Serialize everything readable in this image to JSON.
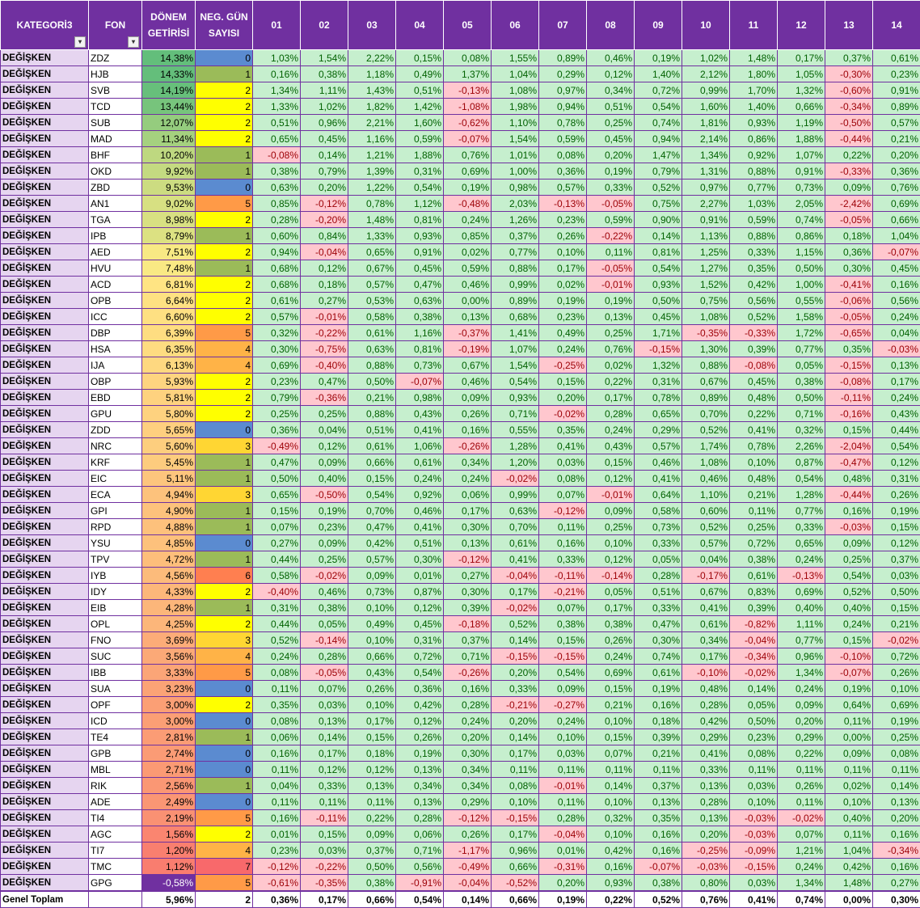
{
  "headers": [
    "KATEGORİ3",
    "FON",
    "DÖNEM GETİRİSİ",
    "NEG. GÜN SAYISI",
    "01",
    "02",
    "03",
    "04",
    "05",
    "06",
    "07",
    "08",
    "09",
    "10",
    "11",
    "12",
    "13",
    "14"
  ],
  "colors": {
    "header_bg": "#7030a0",
    "pos_bg": "#c6efce",
    "pos_fg": "#006100",
    "neg_bg": "#ffc7ce",
    "neg_fg": "#9c0006",
    "cat_bg": "#e6d5f0"
  },
  "rows": [
    {
      "k": "DEĞİŞKEN",
      "f": "ZDZ",
      "g": "14,38%",
      "n": "0",
      "d": [
        "1,03%",
        "1,54%",
        "2,22%",
        "0,15%",
        "0,08%",
        "1,55%",
        "0,89%",
        "0,46%",
        "0,19%",
        "1,02%",
        "1,48%",
        "0,17%",
        "0,37%",
        "0,61%"
      ]
    },
    {
      "k": "DEĞİŞKEN",
      "f": "HJB",
      "g": "14,33%",
      "n": "1",
      "d": [
        "0,16%",
        "0,38%",
        "1,18%",
        "0,49%",
        "1,37%",
        "1,04%",
        "0,29%",
        "0,12%",
        "1,40%",
        "2,12%",
        "1,80%",
        "1,05%",
        "-0,30%",
        "0,23%"
      ]
    },
    {
      "k": "DEĞİŞKEN",
      "f": "SVB",
      "g": "14,19%",
      "n": "2",
      "d": [
        "1,34%",
        "1,11%",
        "1,43%",
        "0,51%",
        "-0,13%",
        "1,08%",
        "0,97%",
        "0,34%",
        "0,72%",
        "0,99%",
        "1,70%",
        "1,32%",
        "-0,60%",
        "0,91%"
      ]
    },
    {
      "k": "DEĞİŞKEN",
      "f": "TCD",
      "g": "13,44%",
      "n": "2",
      "d": [
        "1,33%",
        "1,02%",
        "1,82%",
        "1,42%",
        "-1,08%",
        "1,98%",
        "0,94%",
        "0,51%",
        "0,54%",
        "1,60%",
        "1,40%",
        "0,66%",
        "-0,34%",
        "0,89%"
      ]
    },
    {
      "k": "DEĞİŞKEN",
      "f": "SUB",
      "g": "12,07%",
      "n": "2",
      "d": [
        "0,51%",
        "0,96%",
        "2,21%",
        "1,60%",
        "-0,62%",
        "1,10%",
        "0,78%",
        "0,25%",
        "0,74%",
        "1,81%",
        "0,93%",
        "1,19%",
        "-0,50%",
        "0,57%"
      ]
    },
    {
      "k": "DEĞİŞKEN",
      "f": "MAD",
      "g": "11,34%",
      "n": "2",
      "d": [
        "0,65%",
        "0,45%",
        "1,16%",
        "0,59%",
        "-0,07%",
        "1,54%",
        "0,59%",
        "0,45%",
        "0,94%",
        "2,14%",
        "0,86%",
        "1,88%",
        "-0,44%",
        "0,21%"
      ]
    },
    {
      "k": "DEĞİŞKEN",
      "f": "BHF",
      "g": "10,20%",
      "n": "1",
      "d": [
        "-0,08%",
        "0,14%",
        "1,21%",
        "1,88%",
        "0,76%",
        "1,01%",
        "0,08%",
        "0,20%",
        "1,47%",
        "1,34%",
        "0,92%",
        "1,07%",
        "0,22%",
        "0,20%"
      ]
    },
    {
      "k": "DEĞİŞKEN",
      "f": "OKD",
      "g": "9,92%",
      "n": "1",
      "d": [
        "0,38%",
        "0,79%",
        "1,39%",
        "0,31%",
        "0,69%",
        "1,00%",
        "0,36%",
        "0,19%",
        "0,79%",
        "1,31%",
        "0,88%",
        "0,91%",
        "-0,33%",
        "0,36%"
      ]
    },
    {
      "k": "DEĞİŞKEN",
      "f": "ZBD",
      "g": "9,53%",
      "n": "0",
      "d": [
        "0,63%",
        "0,20%",
        "1,22%",
        "0,54%",
        "0,19%",
        "0,98%",
        "0,57%",
        "0,33%",
        "0,52%",
        "0,97%",
        "0,77%",
        "0,73%",
        "0,09%",
        "0,76%"
      ]
    },
    {
      "k": "DEĞİŞKEN",
      "f": "AN1",
      "g": "9,02%",
      "n": "5",
      "d": [
        "0,85%",
        "-0,12%",
        "0,78%",
        "1,12%",
        "-0,48%",
        "2,03%",
        "-0,13%",
        "-0,05%",
        "0,75%",
        "2,27%",
        "1,03%",
        "2,05%",
        "-2,42%",
        "0,69%"
      ]
    },
    {
      "k": "DEĞİŞKEN",
      "f": "TGA",
      "g": "8,98%",
      "n": "2",
      "d": [
        "0,28%",
        "-0,20%",
        "1,48%",
        "0,81%",
        "0,24%",
        "1,26%",
        "0,23%",
        "0,59%",
        "0,90%",
        "0,91%",
        "0,59%",
        "0,74%",
        "-0,05%",
        "0,66%"
      ]
    },
    {
      "k": "DEĞİŞKEN",
      "f": "IPB",
      "g": "8,79%",
      "n": "1",
      "d": [
        "0,60%",
        "0,84%",
        "1,33%",
        "0,93%",
        "0,85%",
        "0,37%",
        "0,26%",
        "-0,22%",
        "0,14%",
        "1,13%",
        "0,88%",
        "0,86%",
        "0,18%",
        "1,04%"
      ]
    },
    {
      "k": "DEĞİŞKEN",
      "f": "AED",
      "g": "7,51%",
      "n": "2",
      "d": [
        "0,94%",
        "-0,04%",
        "0,65%",
        "0,91%",
        "0,02%",
        "0,77%",
        "0,10%",
        "0,11%",
        "0,81%",
        "1,25%",
        "0,33%",
        "1,15%",
        "0,36%",
        "-0,07%"
      ]
    },
    {
      "k": "DEĞİŞKEN",
      "f": "HVU",
      "g": "7,48%",
      "n": "1",
      "d": [
        "0,68%",
        "0,12%",
        "0,67%",
        "0,45%",
        "0,59%",
        "0,88%",
        "0,17%",
        "-0,05%",
        "0,54%",
        "1,27%",
        "0,35%",
        "0,50%",
        "0,30%",
        "0,45%"
      ]
    },
    {
      "k": "DEĞİŞKEN",
      "f": "ACD",
      "g": "6,81%",
      "n": "2",
      "d": [
        "0,68%",
        "0,18%",
        "0,57%",
        "0,47%",
        "0,46%",
        "0,99%",
        "0,02%",
        "-0,01%",
        "0,93%",
        "1,52%",
        "0,42%",
        "1,00%",
        "-0,41%",
        "0,16%"
      ]
    },
    {
      "k": "DEĞİŞKEN",
      "f": "OPB",
      "g": "6,64%",
      "n": "2",
      "d": [
        "0,61%",
        "0,27%",
        "0,53%",
        "0,63%",
        "0,00%",
        "0,89%",
        "0,19%",
        "0,19%",
        "0,50%",
        "0,75%",
        "0,56%",
        "0,55%",
        "-0,06%",
        "0,56%"
      ]
    },
    {
      "k": "DEĞİŞKEN",
      "f": "ICC",
      "g": "6,60%",
      "n": "2",
      "d": [
        "0,57%",
        "-0,01%",
        "0,58%",
        "0,38%",
        "0,13%",
        "0,68%",
        "0,23%",
        "0,13%",
        "0,45%",
        "1,08%",
        "0,52%",
        "1,58%",
        "-0,05%",
        "0,24%"
      ]
    },
    {
      "k": "DEĞİŞKEN",
      "f": "DBP",
      "g": "6,39%",
      "n": "5",
      "d": [
        "0,32%",
        "-0,22%",
        "0,61%",
        "1,16%",
        "-0,37%",
        "1,41%",
        "0,49%",
        "0,25%",
        "1,71%",
        "-0,35%",
        "-0,33%",
        "1,72%",
        "-0,65%",
        "0,04%"
      ]
    },
    {
      "k": "DEĞİŞKEN",
      "f": "HSA",
      "g": "6,35%",
      "n": "4",
      "d": [
        "0,30%",
        "-0,75%",
        "0,63%",
        "0,81%",
        "-0,19%",
        "1,07%",
        "0,24%",
        "0,76%",
        "-0,15%",
        "1,30%",
        "0,39%",
        "0,77%",
        "0,35%",
        "-0,03%"
      ]
    },
    {
      "k": "DEĞİŞKEN",
      "f": "IJA",
      "g": "6,13%",
      "n": "4",
      "d": [
        "0,69%",
        "-0,40%",
        "0,88%",
        "0,73%",
        "0,67%",
        "1,54%",
        "-0,25%",
        "0,02%",
        "1,32%",
        "0,88%",
        "-0,08%",
        "0,05%",
        "-0,15%",
        "0,13%"
      ]
    },
    {
      "k": "DEĞİŞKEN",
      "f": "OBP",
      "g": "5,93%",
      "n": "2",
      "d": [
        "0,23%",
        "0,47%",
        "0,50%",
        "-0,07%",
        "0,46%",
        "0,54%",
        "0,15%",
        "0,22%",
        "0,31%",
        "0,67%",
        "0,45%",
        "0,38%",
        "-0,08%",
        "0,17%"
      ]
    },
    {
      "k": "DEĞİŞKEN",
      "f": "EBD",
      "g": "5,81%",
      "n": "2",
      "d": [
        "0,79%",
        "-0,36%",
        "0,21%",
        "0,98%",
        "0,09%",
        "0,93%",
        "0,20%",
        "0,17%",
        "0,78%",
        "0,89%",
        "0,48%",
        "0,50%",
        "-0,11%",
        "0,24%"
      ]
    },
    {
      "k": "DEĞİŞKEN",
      "f": "GPU",
      "g": "5,80%",
      "n": "2",
      "d": [
        "0,25%",
        "0,25%",
        "0,88%",
        "0,43%",
        "0,26%",
        "0,71%",
        "-0,02%",
        "0,28%",
        "0,65%",
        "0,70%",
        "0,22%",
        "0,71%",
        "-0,16%",
        "0,43%"
      ]
    },
    {
      "k": "DEĞİŞKEN",
      "f": "ZDD",
      "g": "5,65%",
      "n": "0",
      "d": [
        "0,36%",
        "0,04%",
        "0,51%",
        "0,41%",
        "0,16%",
        "0,55%",
        "0,35%",
        "0,24%",
        "0,29%",
        "0,52%",
        "0,41%",
        "0,32%",
        "0,15%",
        "0,44%"
      ]
    },
    {
      "k": "DEĞİŞKEN",
      "f": "NRC",
      "g": "5,60%",
      "n": "3",
      "d": [
        "-0,49%",
        "0,12%",
        "0,61%",
        "1,06%",
        "-0,26%",
        "1,28%",
        "0,41%",
        "0,43%",
        "0,57%",
        "1,74%",
        "0,78%",
        "2,26%",
        "-2,04%",
        "0,54%"
      ]
    },
    {
      "k": "DEĞİŞKEN",
      "f": "KRF",
      "g": "5,45%",
      "n": "1",
      "d": [
        "0,47%",
        "0,09%",
        "0,66%",
        "0,61%",
        "0,34%",
        "1,20%",
        "0,03%",
        "0,15%",
        "0,46%",
        "1,08%",
        "0,10%",
        "0,87%",
        "-0,47%",
        "0,12%"
      ]
    },
    {
      "k": "DEĞİŞKEN",
      "f": "EIC",
      "g": "5,11%",
      "n": "1",
      "d": [
        "0,50%",
        "0,40%",
        "0,15%",
        "0,24%",
        "0,24%",
        "-0,02%",
        "0,08%",
        "0,12%",
        "0,41%",
        "0,46%",
        "0,48%",
        "0,54%",
        "0,48%",
        "0,31%"
      ]
    },
    {
      "k": "DEĞİŞKEN",
      "f": "ECA",
      "g": "4,94%",
      "n": "3",
      "d": [
        "0,65%",
        "-0,50%",
        "0,54%",
        "0,92%",
        "0,06%",
        "0,99%",
        "0,07%",
        "-0,01%",
        "0,64%",
        "1,10%",
        "0,21%",
        "1,28%",
        "-0,44%",
        "0,26%"
      ]
    },
    {
      "k": "DEĞİŞKEN",
      "f": "GPI",
      "g": "4,90%",
      "n": "1",
      "d": [
        "0,15%",
        "0,19%",
        "0,70%",
        "0,46%",
        "0,17%",
        "0,63%",
        "-0,12%",
        "0,09%",
        "0,58%",
        "0,60%",
        "0,11%",
        "0,77%",
        "0,16%",
        "0,19%"
      ]
    },
    {
      "k": "DEĞİŞKEN",
      "f": "RPD",
      "g": "4,88%",
      "n": "1",
      "d": [
        "0,07%",
        "0,23%",
        "0,47%",
        "0,41%",
        "0,30%",
        "0,70%",
        "0,11%",
        "0,25%",
        "0,73%",
        "0,52%",
        "0,25%",
        "0,33%",
        "-0,03%",
        "0,15%"
      ]
    },
    {
      "k": "DEĞİŞKEN",
      "f": "YSU",
      "g": "4,85%",
      "n": "0",
      "d": [
        "0,27%",
        "0,09%",
        "0,42%",
        "0,51%",
        "0,13%",
        "0,61%",
        "0,16%",
        "0,10%",
        "0,33%",
        "0,57%",
        "0,72%",
        "0,65%",
        "0,09%",
        "0,12%"
      ]
    },
    {
      "k": "DEĞİŞKEN",
      "f": "TPV",
      "g": "4,72%",
      "n": "1",
      "d": [
        "0,44%",
        "0,25%",
        "0,57%",
        "0,30%",
        "-0,12%",
        "0,41%",
        "0,33%",
        "0,12%",
        "0,05%",
        "0,04%",
        "0,38%",
        "0,24%",
        "0,25%",
        "0,37%"
      ]
    },
    {
      "k": "DEĞİŞKEN",
      "f": "IYB",
      "g": "4,56%",
      "n": "6",
      "d": [
        "0,58%",
        "-0,02%",
        "0,09%",
        "0,01%",
        "0,27%",
        "-0,04%",
        "-0,11%",
        "-0,14%",
        "0,28%",
        "-0,17%",
        "0,61%",
        "-0,13%",
        "0,54%",
        "0,03%"
      ]
    },
    {
      "k": "DEĞİŞKEN",
      "f": "IDY",
      "g": "4,33%",
      "n": "2",
      "d": [
        "-0,40%",
        "0,46%",
        "0,73%",
        "0,87%",
        "0,30%",
        "0,17%",
        "-0,21%",
        "0,05%",
        "0,51%",
        "0,67%",
        "0,83%",
        "0,69%",
        "0,52%",
        "0,50%"
      ]
    },
    {
      "k": "DEĞİŞKEN",
      "f": "EIB",
      "g": "4,28%",
      "n": "1",
      "d": [
        "0,31%",
        "0,38%",
        "0,10%",
        "0,12%",
        "0,39%",
        "-0,02%",
        "0,07%",
        "0,17%",
        "0,33%",
        "0,41%",
        "0,39%",
        "0,40%",
        "0,40%",
        "0,15%"
      ]
    },
    {
      "k": "DEĞİŞKEN",
      "f": "OPL",
      "g": "4,25%",
      "n": "2",
      "d": [
        "0,44%",
        "0,05%",
        "0,49%",
        "0,45%",
        "-0,18%",
        "0,52%",
        "0,38%",
        "0,38%",
        "0,47%",
        "0,61%",
        "-0,82%",
        "1,11%",
        "0,24%",
        "0,21%"
      ]
    },
    {
      "k": "DEĞİŞKEN",
      "f": "FNO",
      "g": "3,69%",
      "n": "3",
      "d": [
        "0,52%",
        "-0,14%",
        "0,10%",
        "0,31%",
        "0,37%",
        "0,14%",
        "0,15%",
        "0,26%",
        "0,30%",
        "0,34%",
        "-0,04%",
        "0,77%",
        "0,15%",
        "-0,02%"
      ]
    },
    {
      "k": "DEĞİŞKEN",
      "f": "SUC",
      "g": "3,56%",
      "n": "4",
      "d": [
        "0,24%",
        "0,28%",
        "0,66%",
        "0,72%",
        "0,71%",
        "-0,15%",
        "-0,15%",
        "0,24%",
        "0,74%",
        "0,17%",
        "-0,34%",
        "0,96%",
        "-0,10%",
        "0,72%"
      ]
    },
    {
      "k": "DEĞİŞKEN",
      "f": "IBB",
      "g": "3,33%",
      "n": "5",
      "d": [
        "0,08%",
        "-0,05%",
        "0,43%",
        "0,54%",
        "-0,26%",
        "0,20%",
        "0,54%",
        "0,69%",
        "0,61%",
        "-0,10%",
        "-0,02%",
        "1,34%",
        "-0,07%",
        "0,26%"
      ]
    },
    {
      "k": "DEĞİŞKEN",
      "f": "SUA",
      "g": "3,23%",
      "n": "0",
      "d": [
        "0,11%",
        "0,07%",
        "0,26%",
        "0,36%",
        "0,16%",
        "0,33%",
        "0,09%",
        "0,15%",
        "0,19%",
        "0,48%",
        "0,14%",
        "0,24%",
        "0,19%",
        "0,10%"
      ]
    },
    {
      "k": "DEĞİŞKEN",
      "f": "OPF",
      "g": "3,00%",
      "n": "2",
      "d": [
        "0,35%",
        "0,03%",
        "0,10%",
        "0,42%",
        "0,28%",
        "-0,21%",
        "-0,27%",
        "0,21%",
        "0,16%",
        "0,28%",
        "0,05%",
        "0,09%",
        "0,64%",
        "0,69%"
      ]
    },
    {
      "k": "DEĞİŞKEN",
      "f": "ICD",
      "g": "3,00%",
      "n": "0",
      "d": [
        "0,08%",
        "0,13%",
        "0,17%",
        "0,12%",
        "0,24%",
        "0,20%",
        "0,24%",
        "0,10%",
        "0,18%",
        "0,42%",
        "0,50%",
        "0,20%",
        "0,11%",
        "0,19%"
      ]
    },
    {
      "k": "DEĞİŞKEN",
      "f": "TE4",
      "g": "2,81%",
      "n": "1",
      "d": [
        "0,06%",
        "0,14%",
        "0,15%",
        "0,26%",
        "0,20%",
        "0,14%",
        "0,10%",
        "0,15%",
        "0,39%",
        "0,29%",
        "0,23%",
        "0,29%",
        "0,00%",
        "0,25%"
      ]
    },
    {
      "k": "DEĞİŞKEN",
      "f": "GPB",
      "g": "2,74%",
      "n": "0",
      "d": [
        "0,16%",
        "0,17%",
        "0,18%",
        "0,19%",
        "0,30%",
        "0,17%",
        "0,03%",
        "0,07%",
        "0,21%",
        "0,41%",
        "0,08%",
        "0,22%",
        "0,09%",
        "0,08%"
      ]
    },
    {
      "k": "DEĞİŞKEN",
      "f": "MBL",
      "g": "2,71%",
      "n": "0",
      "d": [
        "0,11%",
        "0,12%",
        "0,12%",
        "0,13%",
        "0,34%",
        "0,11%",
        "0,11%",
        "0,11%",
        "0,11%",
        "0,33%",
        "0,11%",
        "0,11%",
        "0,11%",
        "0,11%"
      ]
    },
    {
      "k": "DEĞİŞKEN",
      "f": "RIK",
      "g": "2,56%",
      "n": "1",
      "d": [
        "0,04%",
        "0,33%",
        "0,13%",
        "0,34%",
        "0,34%",
        "0,08%",
        "-0,01%",
        "0,14%",
        "0,37%",
        "0,13%",
        "0,03%",
        "0,26%",
        "0,02%",
        "0,14%"
      ]
    },
    {
      "k": "DEĞİŞKEN",
      "f": "ADE",
      "g": "2,49%",
      "n": "0",
      "d": [
        "0,11%",
        "0,11%",
        "0,11%",
        "0,13%",
        "0,29%",
        "0,10%",
        "0,11%",
        "0,10%",
        "0,13%",
        "0,28%",
        "0,10%",
        "0,11%",
        "0,10%",
        "0,13%"
      ]
    },
    {
      "k": "DEĞİŞKEN",
      "f": "TI4",
      "g": "2,19%",
      "n": "5",
      "d": [
        "0,16%",
        "-0,11%",
        "0,22%",
        "0,28%",
        "-0,12%",
        "-0,15%",
        "0,28%",
        "0,32%",
        "0,35%",
        "0,13%",
        "-0,03%",
        "-0,02%",
        "0,40%",
        "0,20%"
      ]
    },
    {
      "k": "DEĞİŞKEN",
      "f": "AGC",
      "g": "1,56%",
      "n": "2",
      "d": [
        "0,01%",
        "0,15%",
        "0,09%",
        "0,06%",
        "0,26%",
        "0,17%",
        "-0,04%",
        "0,10%",
        "0,16%",
        "0,20%",
        "-0,03%",
        "0,07%",
        "0,11%",
        "0,16%"
      ]
    },
    {
      "k": "DEĞİŞKEN",
      "f": "TI7",
      "g": "1,20%",
      "n": "4",
      "d": [
        "0,23%",
        "0,03%",
        "0,37%",
        "0,71%",
        "-1,17%",
        "0,96%",
        "0,01%",
        "0,42%",
        "0,16%",
        "-0,25%",
        "-0,09%",
        "1,21%",
        "1,04%",
        "-0,34%"
      ]
    },
    {
      "k": "DEĞİŞKEN",
      "f": "TMC",
      "g": "1,12%",
      "n": "7",
      "d": [
        "-0,12%",
        "-0,22%",
        "0,50%",
        "0,56%",
        "-0,49%",
        "0,66%",
        "-0,31%",
        "0,16%",
        "-0,07%",
        "-0,03%",
        "-0,15%",
        "0,24%",
        "0,42%",
        "0,16%"
      ]
    },
    {
      "k": "DEĞİŞKEN",
      "f": "GPG",
      "g": "-0,58%",
      "n": "5",
      "d": [
        "-0,61%",
        "-0,35%",
        "0,38%",
        "-0,91%",
        "-0,04%",
        "-0,52%",
        "0,20%",
        "0,93%",
        "0,38%",
        "0,80%",
        "0,03%",
        "1,34%",
        "1,48%",
        "0,27%"
      ]
    }
  ],
  "total": {
    "label": "Genel Toplam",
    "g": "5,96%",
    "n": "2",
    "d": [
      "0,36%",
      "0,17%",
      "0,66%",
      "0,54%",
      "0,14%",
      "0,66%",
      "0,19%",
      "0,22%",
      "0,52%",
      "0,76%",
      "0,41%",
      "0,74%",
      "0,00%",
      "0,30%"
    ]
  }
}
